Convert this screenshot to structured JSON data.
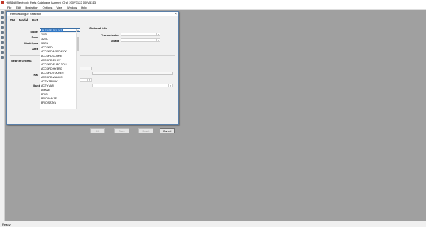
{
  "window": {
    "title": "HONDA Electronic Parts Catalogue  (Admin)  (Ora)  200V3122  100V5313"
  },
  "menu": [
    "File",
    "Edit",
    "Illustration",
    "Options",
    "View",
    "Window",
    "Help"
  ],
  "status": "Ready",
  "dialog": {
    "title": "Partscatalogue Selection",
    "tabs": [
      "VIN",
      "Model",
      "Part"
    ],
    "labels": {
      "model": "Model",
      "door": "Door",
      "model_year": "Modelyear",
      "area": "Area",
      "search_criteria": "Search Criteria",
      "par": "Par",
      "illust": "Illust",
      "optional_info": "Optional Info",
      "transmission": "Transmission",
      "grade": "Grade"
    },
    "model_select": {
      "value": "PLEASE SELECT"
    },
    "dropdown_items": [
      "2.0TL",
      "3.2TL",
      "3.5RL",
      "ACCORD",
      "ACCORD AEROdECK",
      "ACCORD COUPE",
      "ACCORD E:HEV",
      "ACCORD EURO TOU",
      "ACCORD HYBRID",
      "ACCORD TOURER",
      "ACCORD WAGON",
      "ACTY TRUCK",
      "ACTY VAN",
      "AMAZE",
      "BRIO",
      "BRIO AMAZE",
      "BRIO SATYA"
    ],
    "buttons": {
      "ok": "OK",
      "save": "Save",
      "reset": "Reset",
      "cancel": "Cancel"
    }
  },
  "toolbar_icons": [
    "back-icon",
    "forward-icon",
    "catalogue-icon",
    "parts-icon",
    "search-icon",
    "print-icon",
    "settings-icon",
    "cart-icon",
    "home-icon",
    "help-icon"
  ]
}
